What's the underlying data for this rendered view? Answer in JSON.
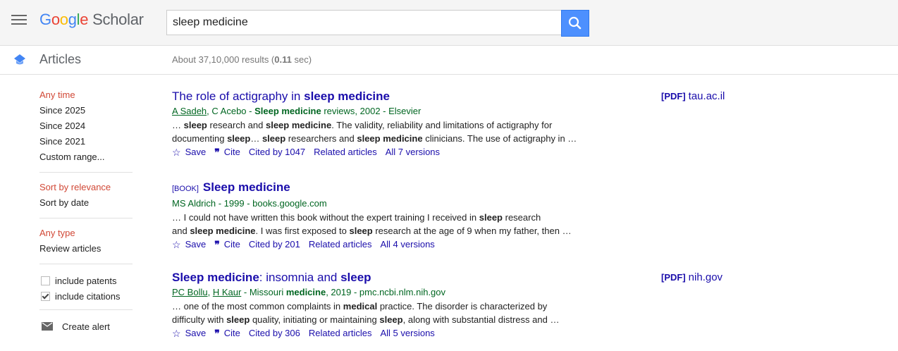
{
  "header": {
    "logo_google": [
      "G",
      "o",
      "o",
      "g",
      "l",
      "e"
    ],
    "logo_scholar": "Scholar",
    "search_value": "sleep medicine"
  },
  "subbar": {
    "section": "Articles",
    "results_prefix": "About 37,10,000 results (",
    "results_time": "0.11",
    "results_suffix": " sec)"
  },
  "sidebar": {
    "time": [
      "Any time",
      "Since 2025",
      "Since 2024",
      "Since 2021",
      "Custom range..."
    ],
    "sort": [
      "Sort by relevance",
      "Sort by date"
    ],
    "type": [
      "Any type",
      "Review articles"
    ],
    "include_patents": "include patents",
    "include_citations": "include citations",
    "create_alert": "Create alert"
  },
  "results": [
    {
      "title_pre": "The role of actigraphy in ",
      "title_bold": "sleep medicine",
      "authors_linked": "A Sadeh",
      "authors_rest": ", C Acebo - ",
      "venue_bold": "Sleep medicine",
      "venue_rest": " reviews, 2002 - Elsevier",
      "snippet1_parts": [
        "… ",
        "sleep",
        " research and ",
        "sleep medicine",
        ". The validity, reliability and limitations of actigraphy for"
      ],
      "snippet2_parts": [
        "documenting ",
        "sleep",
        "… ",
        "sleep",
        " researchers and ",
        "sleep medicine",
        " clinicians. The use of actigraphy in …"
      ],
      "save": "Save",
      "cite": "Cite",
      "cited_by": "Cited by 1047",
      "related": "Related articles",
      "versions": "All 7 versions",
      "pdf_tag": "[PDF]",
      "pdf_source": "tau.ac.il"
    },
    {
      "tag": "[BOOK]",
      "title_bold": "Sleep medicine",
      "authors_plain": "MS Aldrich - 1999 - books.google.com",
      "snippet1_parts": [
        "… I could not have written this book without the expert training I received in ",
        "sleep",
        " research"
      ],
      "snippet2_parts": [
        "and ",
        "sleep medicine",
        ". I was first exposed to ",
        "sleep",
        " research at the age of 9 when my father, then …"
      ],
      "save": "Save",
      "cite": "Cite",
      "cited_by": "Cited by 201",
      "related": "Related articles",
      "versions": "All 4 versions"
    },
    {
      "title_bold": "Sleep medicine",
      "title_mid": ": insomnia and ",
      "title_bold2": "sleep",
      "authors_linked1": "PC Bollu",
      "authors_sep": ", ",
      "authors_linked2": "H Kaur",
      "authors_rest": " - Missouri ",
      "venue_bold": "medicine",
      "venue_rest": ", 2019 - pmc.ncbi.nlm.nih.gov",
      "snippet1_parts": [
        "… one of the most common complaints in ",
        "medical",
        " practice. The disorder is characterized by"
      ],
      "snippet2_parts": [
        "difficulty with ",
        "sleep",
        " quality, initiating or maintaining ",
        "sleep",
        ", along with substantial distress and …"
      ],
      "save": "Save",
      "cite": "Cite",
      "cited_by": "Cited by 306",
      "related": "Related articles",
      "versions": "All 5 versions",
      "pdf_tag": "[PDF]",
      "pdf_source": "nih.gov"
    }
  ],
  "colors": {
    "link": "#1a0dab",
    "green": "#006621",
    "active": "#d14836",
    "search_btn": "#4d90fe"
  }
}
